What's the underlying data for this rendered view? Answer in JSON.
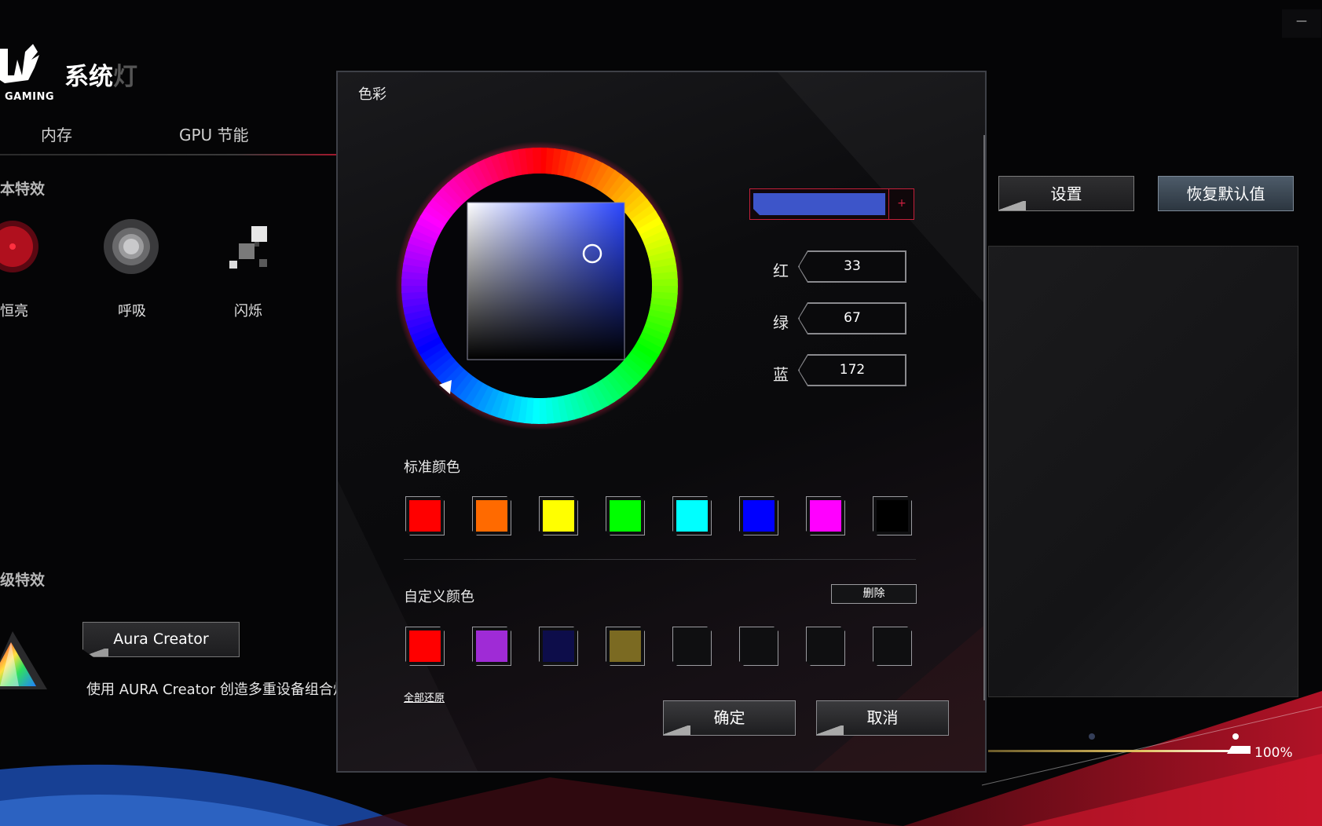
{
  "window": {
    "minimize_glyph": "—"
  },
  "app": {
    "logo_text": "GAMING",
    "title": "系统",
    "title_fade": "灯"
  },
  "tabs": [
    {
      "label": "内存"
    },
    {
      "label": "GPU 节能"
    }
  ],
  "basic_effects": {
    "heading": "本特效",
    "items": [
      {
        "label": "恒亮",
        "icon": "static-icon"
      },
      {
        "label": "呼吸",
        "icon": "breathing-icon"
      },
      {
        "label": "闪烁",
        "icon": "flash-icon"
      }
    ]
  },
  "advanced_effects": {
    "heading": "级特效",
    "aura_button": "Aura Creator",
    "aura_desc": "使用 AURA Creator 创造多重设备组合灯效"
  },
  "right": {
    "settings_button": "设置",
    "reset_button": "恢复默认值",
    "slider_value": "100%",
    "slider_percent": 100
  },
  "dialog": {
    "title": "色彩",
    "preview_color": "#3d55c9",
    "add_glyph": "+",
    "rgb": {
      "red_label": "红",
      "red_value": "33",
      "green_label": "绿",
      "green_value": "67",
      "blue_label": "蓝",
      "blue_value": "172"
    },
    "standard_label": "标准颜色",
    "standard_colors": [
      "#ff0000",
      "#ff6a00",
      "#ffff00",
      "#00ff00",
      "#00ffff",
      "#0000ff",
      "#ff00ff",
      "#000000"
    ],
    "custom_label": "自定义颜色",
    "delete_button": "删除",
    "custom_colors": [
      "#ff0000",
      "#9f2bd6",
      "#0d0d4a",
      "#7b6a22",
      "",
      "",
      "",
      ""
    ],
    "restore_all": "全部还原",
    "ok_button": "确定",
    "cancel_button": "取消"
  }
}
